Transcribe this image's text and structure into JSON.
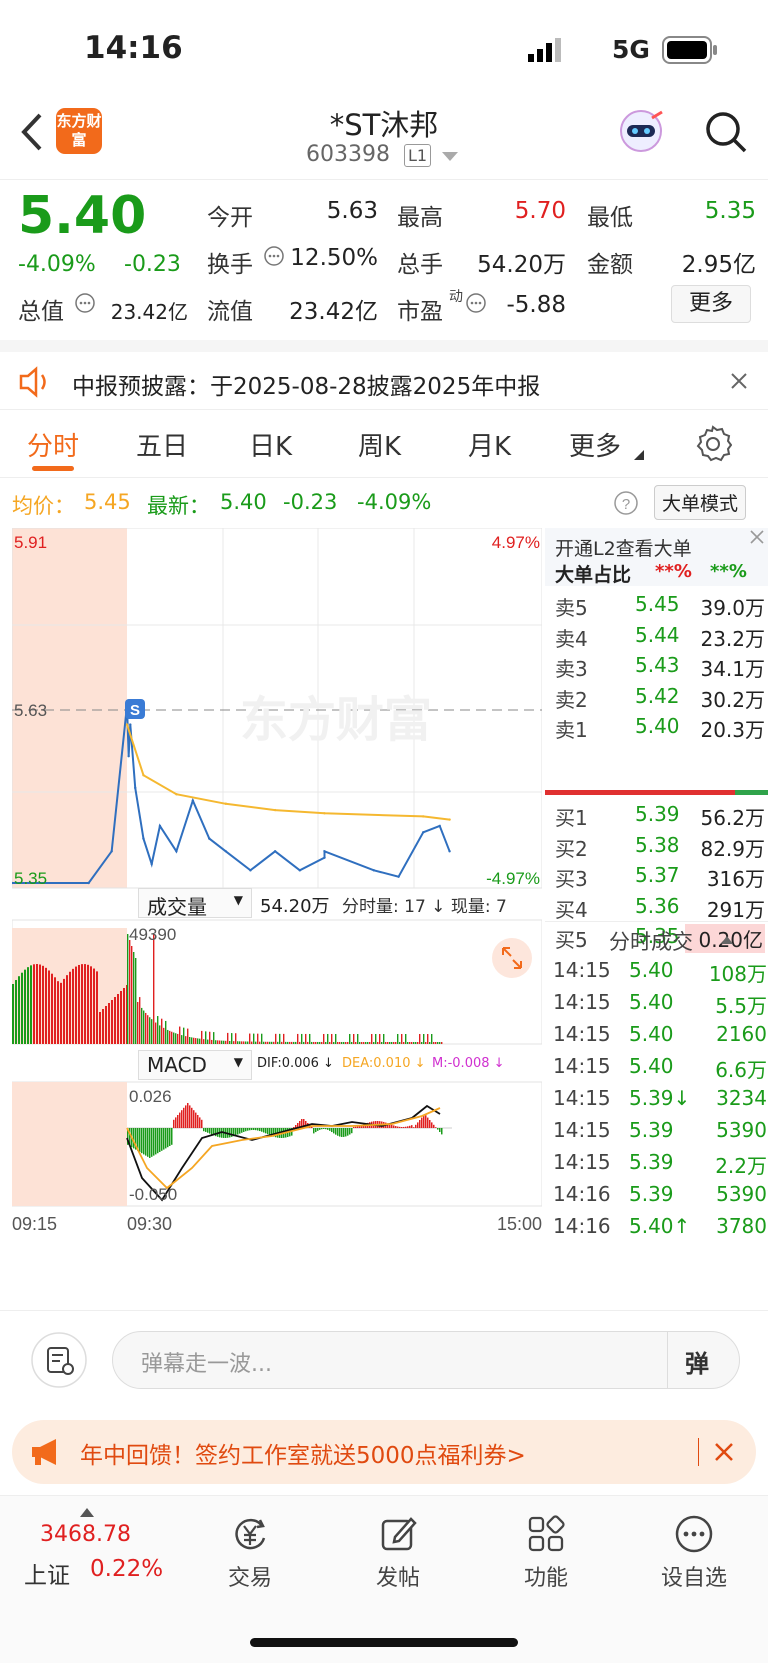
{
  "status": {
    "time": "14:16",
    "network": "5G"
  },
  "header": {
    "logo_text": "东方财富",
    "title": "*ST沐邦",
    "code": "603398",
    "level_badge": "L1"
  },
  "quote": {
    "price": "5.40",
    "change_pct": "-4.09%",
    "change": "-0.23",
    "fields": [
      {
        "label": "今开",
        "value": "5.63",
        "color": "#222222"
      },
      {
        "label": "最高",
        "value": "5.70",
        "color": "#e02020"
      },
      {
        "label": "最低",
        "value": "5.35",
        "color": "#1a9b1a"
      },
      {
        "label": "换手",
        "value": "12.50%",
        "color": "#222222"
      },
      {
        "label": "总手",
        "value": "54.20万",
        "color": "#222222"
      },
      {
        "label": "金额",
        "value": "2.95亿",
        "color": "#222222"
      },
      {
        "label": "总值",
        "value": "23.42亿",
        "color": "#222222"
      },
      {
        "label": "流值",
        "value": "23.42亿",
        "color": "#222222"
      },
      {
        "label": "市盈",
        "value": "-5.88",
        "color": "#222222"
      }
    ],
    "pe_sup": "动",
    "more_label": "更多"
  },
  "notice": {
    "text": "中报预披露：于2025-08-28披露2025年中报"
  },
  "tabs": [
    "分时",
    "五日",
    "日K",
    "周K",
    "月K",
    "更多"
  ],
  "active_tab": "分时",
  "infobar": {
    "avg_label": "均价：",
    "avg_value": "5.45",
    "latest_label": "最新：",
    "latest_value": "5.40",
    "latest_change": "-0.23",
    "latest_pct": "-4.09%",
    "mode_button": "大单模式"
  },
  "chart": {
    "price_high": "5.91",
    "price_open": "5.63",
    "price_low": "5.35",
    "pct_high": "4.97%",
    "pct_low": "-4.97%",
    "watermark": "东方财富",
    "volume_selector": "成交量",
    "volume_total": "54.20万",
    "volume_detail": "分时量: 17 ↓ 现量: 7",
    "volume_max_label": "49390",
    "macd_selector": "MACD",
    "dif": "DIF:0.006 ↓",
    "dea": "DEA:0.010 ↓",
    "m": "M:-0.008 ↓",
    "macd_top": "0.026",
    "macd_bottom": "-0.050",
    "time_start": "09:15",
    "time_open": "09:30",
    "time_end": "15:00",
    "colors": {
      "up": "#e02020",
      "down": "#1a9b1a",
      "price_line": "#2f6fbf",
      "avg_line": "#f5b830",
      "pre_market": "#fde2d6"
    }
  },
  "chart_data": {
    "type": "line",
    "title": "",
    "x_range": [
      "09:15",
      "15:00"
    ],
    "ylim": [
      5.35,
      5.91
    ],
    "series": [
      {
        "name": "",
        "x": [
          "09:15",
          "09:25",
          "09:28",
          "09:30",
          "09:31",
          "09:32",
          "09:35",
          "09:40",
          "09:45",
          "09:50",
          "10:00",
          "10:10",
          "10:20",
          "10:30",
          "10:45",
          "11:00",
          "11:15",
          "11:30",
          "13:00",
          "13:30",
          "13:45",
          "14:00",
          "14:10",
          "14:16"
        ],
        "values": [
          5.35,
          5.35,
          5.4,
          5.63,
          5.55,
          5.6,
          5.5,
          5.42,
          5.38,
          5.44,
          5.4,
          5.48,
          5.42,
          5.4,
          5.37,
          5.4,
          5.37,
          5.39,
          5.4,
          5.37,
          5.36,
          5.43,
          5.44,
          5.4
        ]
      },
      {
        "name": "",
        "x": [
          "09:30",
          "09:40",
          "10:00",
          "10:30",
          "11:00",
          "13:00",
          "14:00",
          "14:16"
        ],
        "values": [
          5.6,
          5.52,
          5.49,
          5.475,
          5.465,
          5.46,
          5.455,
          5.45
        ]
      }
    ]
  },
  "orderbook": {
    "promo_title": "开通L2查看大单",
    "ratio_label": "大单占比",
    "ratio_red": "**%",
    "ratio_green": "**%",
    "sells": [
      {
        "label": "卖5",
        "price": "5.45",
        "vol": "39.0万"
      },
      {
        "label": "卖4",
        "price": "5.44",
        "vol": "23.2万"
      },
      {
        "label": "卖3",
        "price": "5.43",
        "vol": "34.1万"
      },
      {
        "label": "卖2",
        "price": "5.42",
        "vol": "30.2万"
      },
      {
        "label": "卖1",
        "price": "5.40",
        "vol": "20.3万"
      }
    ],
    "buys": [
      {
        "label": "买1",
        "price": "5.39",
        "vol": "56.2万"
      },
      {
        "label": "买2",
        "price": "5.38",
        "vol": "82.9万"
      },
      {
        "label": "买3",
        "price": "5.37",
        "vol": "316万"
      },
      {
        "label": "买4",
        "price": "5.36",
        "vol": "291万"
      },
      {
        "label": "买5",
        "price": "5.35",
        "vol": "0.20亿"
      }
    ],
    "trades_title": "分时成交",
    "trades": [
      {
        "time": "14:15",
        "price": "5.40",
        "vol": "108万"
      },
      {
        "time": "14:15",
        "price": "5.40",
        "vol": "5.5万"
      },
      {
        "time": "14:15",
        "price": "5.40",
        "vol": "2160"
      },
      {
        "time": "14:15",
        "price": "5.40",
        "vol": "6.6万"
      },
      {
        "time": "14:15",
        "price": "5.39↓",
        "vol": "3234"
      },
      {
        "time": "14:15",
        "price": "5.39",
        "vol": "5390"
      },
      {
        "time": "14:15",
        "price": "5.39",
        "vol": "2.2万"
      },
      {
        "time": "14:16",
        "price": "5.39",
        "vol": "5390"
      },
      {
        "time": "14:16",
        "price": "5.40↑",
        "vol": "3780"
      }
    ]
  },
  "comment": {
    "placeholder": "弹幕走一波...",
    "send_glyph": "弹"
  },
  "promo": {
    "text": "年中回馈！签约工作室就送5000点福利券>"
  },
  "nav": {
    "index_value": "3468.78",
    "index_name": "上证",
    "index_pct": "0.22%",
    "items": [
      {
        "label": "交易",
        "icon": "yen-exchange-icon"
      },
      {
        "label": "发帖",
        "icon": "edit-icon"
      },
      {
        "label": "功能",
        "icon": "grid-icon"
      },
      {
        "label": "设自选",
        "icon": "more-dots-icon"
      }
    ]
  }
}
